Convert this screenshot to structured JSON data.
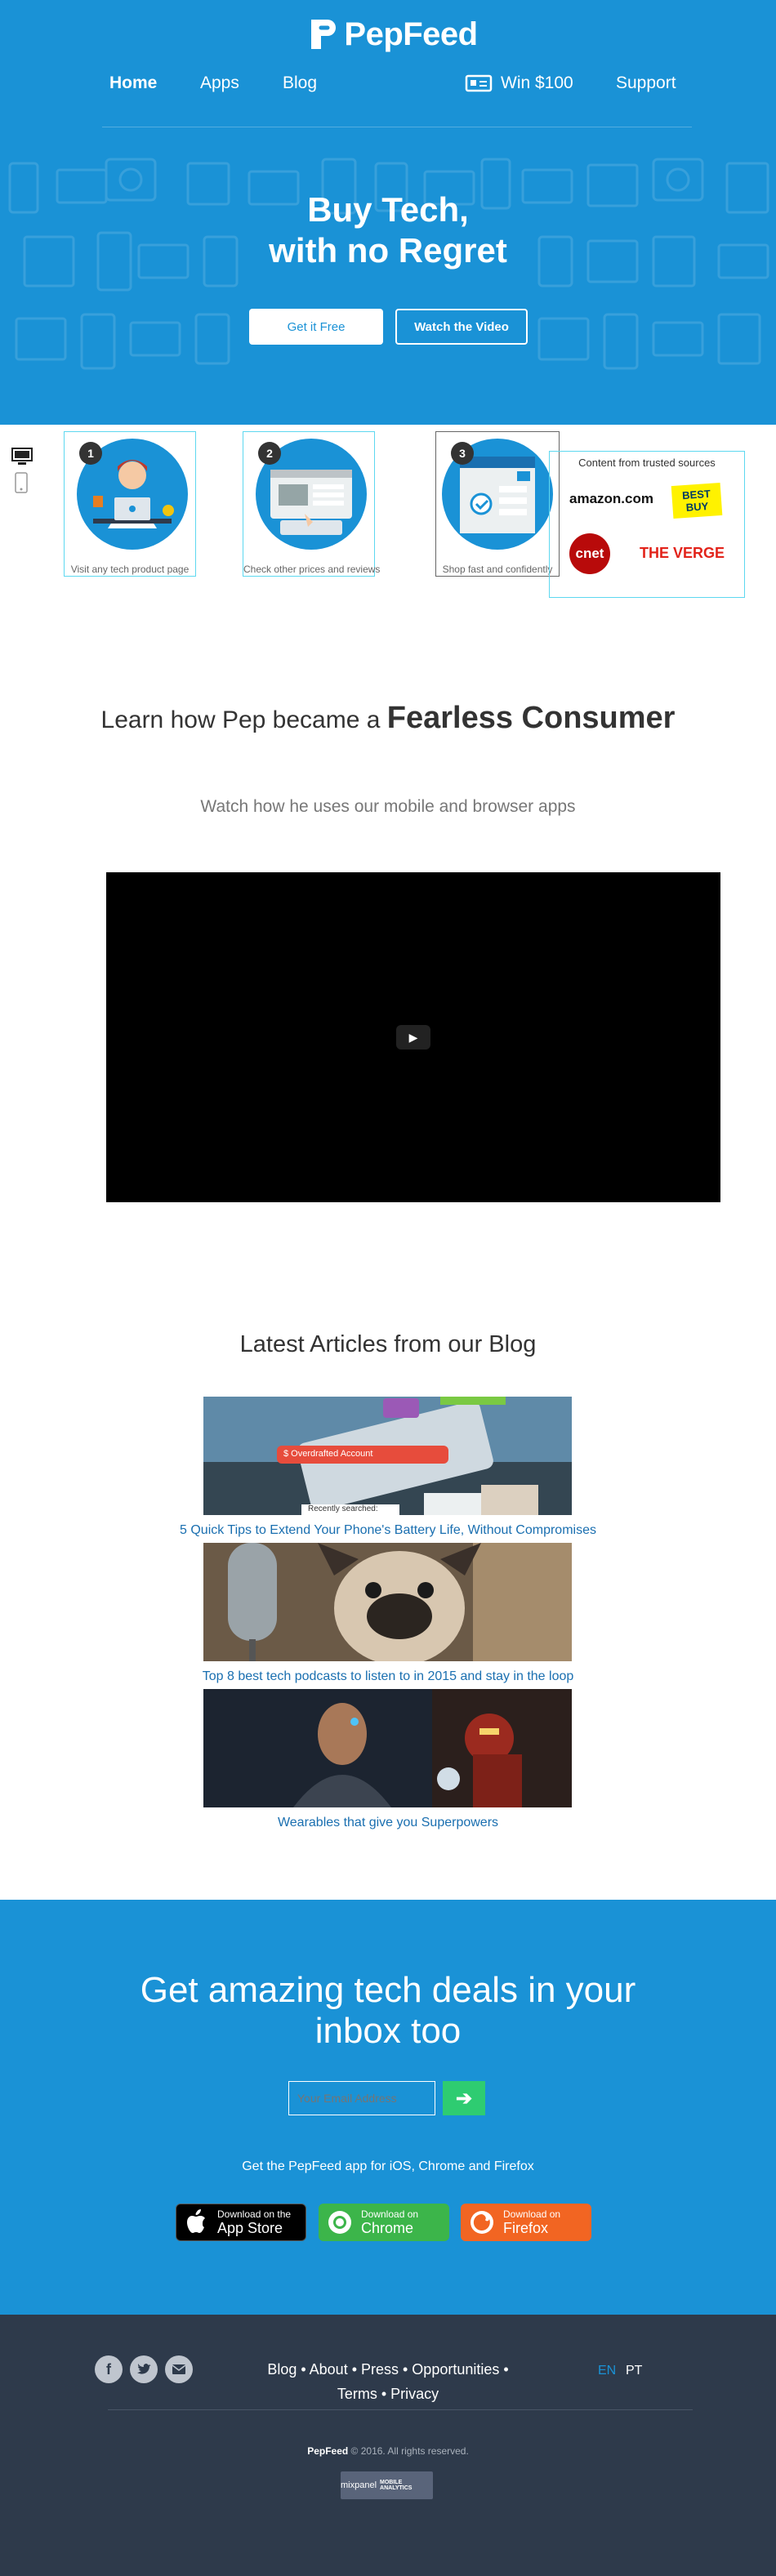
{
  "header": {
    "brand": "PepFeed",
    "nav": {
      "home": "Home",
      "apps": "Apps",
      "blog": "Blog",
      "win": "Win $100",
      "support": "Support"
    },
    "title_line1": "Buy Tech,",
    "title_line2": "with no Regret",
    "cta_primary": "Get it Free",
    "cta_secondary": "Watch the Video"
  },
  "steps": [
    {
      "number": "1",
      "caption": "Visit any tech product page"
    },
    {
      "number": "2",
      "caption": "Check other prices and reviews"
    },
    {
      "number": "3",
      "caption": "Shop fast and confidently"
    }
  ],
  "sources": {
    "title": "Content from trusted sources",
    "logos": [
      "amazon.com",
      "BEST BUY",
      "cnet",
      "THE VERGE"
    ]
  },
  "promo": {
    "heading_prefix": "Learn how Pep became a",
    "heading_emphasis": "Fearless Consumer",
    "subheading": "Watch how he uses our mobile and browser apps"
  },
  "blog": {
    "heading": "Latest Articles from our Blog",
    "articles": [
      {
        "title": "5 Quick Tips to Extend Your Phone's Battery Life, Without Compromises",
        "image_text": "$ Overdrafted Account",
        "image_text2": "Recently searched:"
      },
      {
        "title": "Top 8 best tech podcasts to listen to in 2015 and stay in the loop"
      },
      {
        "title": "Wearables that give you Superpowers"
      }
    ]
  },
  "newsletter": {
    "heading_line1": "Get amazing tech deals in your",
    "heading_line2": "inbox too",
    "email_placeholder": "Your Email Address",
    "submit_glyph": "➔",
    "apps_text": "Get the PepFeed app for iOS, Chrome and Firefox",
    "stores": [
      {
        "small": "Download on the",
        "big": "App Store",
        "color": "#000000"
      },
      {
        "small": "Download on",
        "big": "Chrome",
        "color": "#3cb54a"
      },
      {
        "small": "Download on",
        "big": "Firefox",
        "color": "#f26522"
      }
    ]
  },
  "footer": {
    "links_line1": "Blog • About • Press • Opportunities •",
    "links_line2": "Terms • Privacy",
    "lang_en": "EN",
    "lang_pt": "PT",
    "copyright_brand": "PepFeed",
    "copyright": "© 2016. All rights reserved.",
    "badge_line1": "mixpanel",
    "badge_line2": "MOBILE ANALYTICS"
  },
  "colors": {
    "brand_blue": "#1a92d6",
    "footer": "#2e3a4b",
    "accent_green": "#2ecc71",
    "link": "#1a6fb0"
  }
}
